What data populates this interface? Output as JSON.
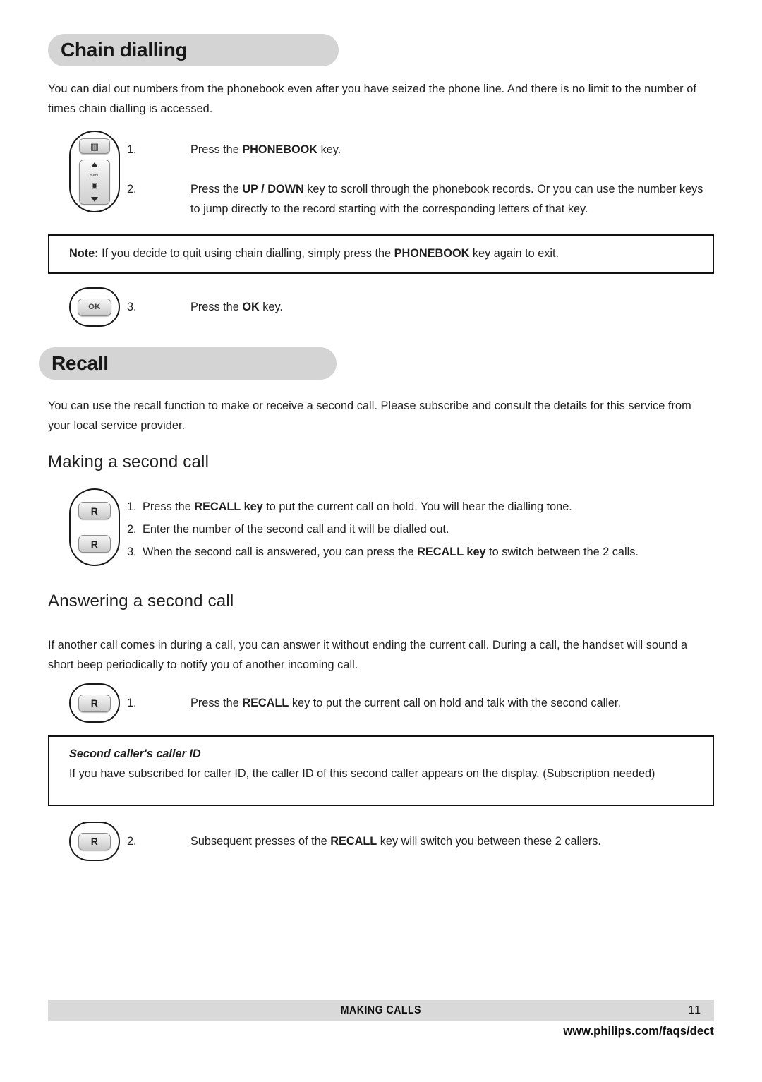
{
  "sections": {
    "chain": {
      "title": "Chain dialling",
      "intro": "You can dial out numbers from the phonebook even after you have seized the phone line.  And there is no limit to the number of times chain dialling is accessed.",
      "steps": [
        {
          "num": "1.",
          "html": "Press the <b>PHONEBOOK</b> key."
        },
        {
          "num": "2.",
          "html": "Press the <b>UP / DOWN</b> key to scroll through the phonebook records.  Or you can use the number keys to jump directly to the record starting with the corresponding letters of that key."
        }
      ],
      "note": "If you decide to quit using chain dialling, simply press the PHONEBOOK key again to exit.",
      "note_label": "Note:",
      "note_html": "<b>Note:</b>  If you decide to quit using chain dialling, simply press the <b>PHONEBOOK</b> key again to exit.",
      "step3": {
        "num": "3.",
        "html": "Press the <b>OK</b> key."
      }
    },
    "recall": {
      "title": "Recall",
      "intro": "You can use the recall function to make or receive a second call.  Please subscribe and consult the details for this service from your local service provider.",
      "making": {
        "heading": "Making a second call",
        "steps": [
          {
            "num": "1.",
            "html": "Press the <b>RECALL key</b> to put the current call on hold. You will hear the dialling tone."
          },
          {
            "num": "2.",
            "html": "Enter the number of the second call and it will be dialled out."
          },
          {
            "num": "3.",
            "html": "When the second call is answered, you can press the <b>RECALL key</b> to switch between the 2 calls."
          }
        ]
      },
      "answering": {
        "heading": "Answering a second call",
        "intro": "If another call comes in during a call, you can answer it without ending the current call.  During a call, the handset will sound a short beep periodically to notify you of another incoming call.",
        "step1": {
          "num": "1.",
          "html": "Press the <b>RECALL</b> key to put the current call on hold and talk with the second caller."
        },
        "callout": {
          "title": "Second caller's caller ID",
          "body": "If you have subscribed for caller ID, the caller ID of this second caller appears on the display.  (Subscription needed)"
        },
        "step2": {
          "num": "2.",
          "html": "Subsequent presses of the <b>RECALL</b> key will switch you between these 2 callers."
        }
      }
    }
  },
  "keys": {
    "phonebook_glyph": "▥",
    "nav_menu_label": "menu",
    "nav_mid_glyph": "▣",
    "ok_label": "OK",
    "recall_label": "R"
  },
  "footer": {
    "title": "MAKING CALLS",
    "page": "11",
    "url": "www.philips.com/faqs/dect"
  },
  "colors": {
    "banner_bg": "#d4d4d4",
    "footer_bg": "#d9d9d9",
    "text": "#1f1f1f",
    "rule": "#111111"
  }
}
